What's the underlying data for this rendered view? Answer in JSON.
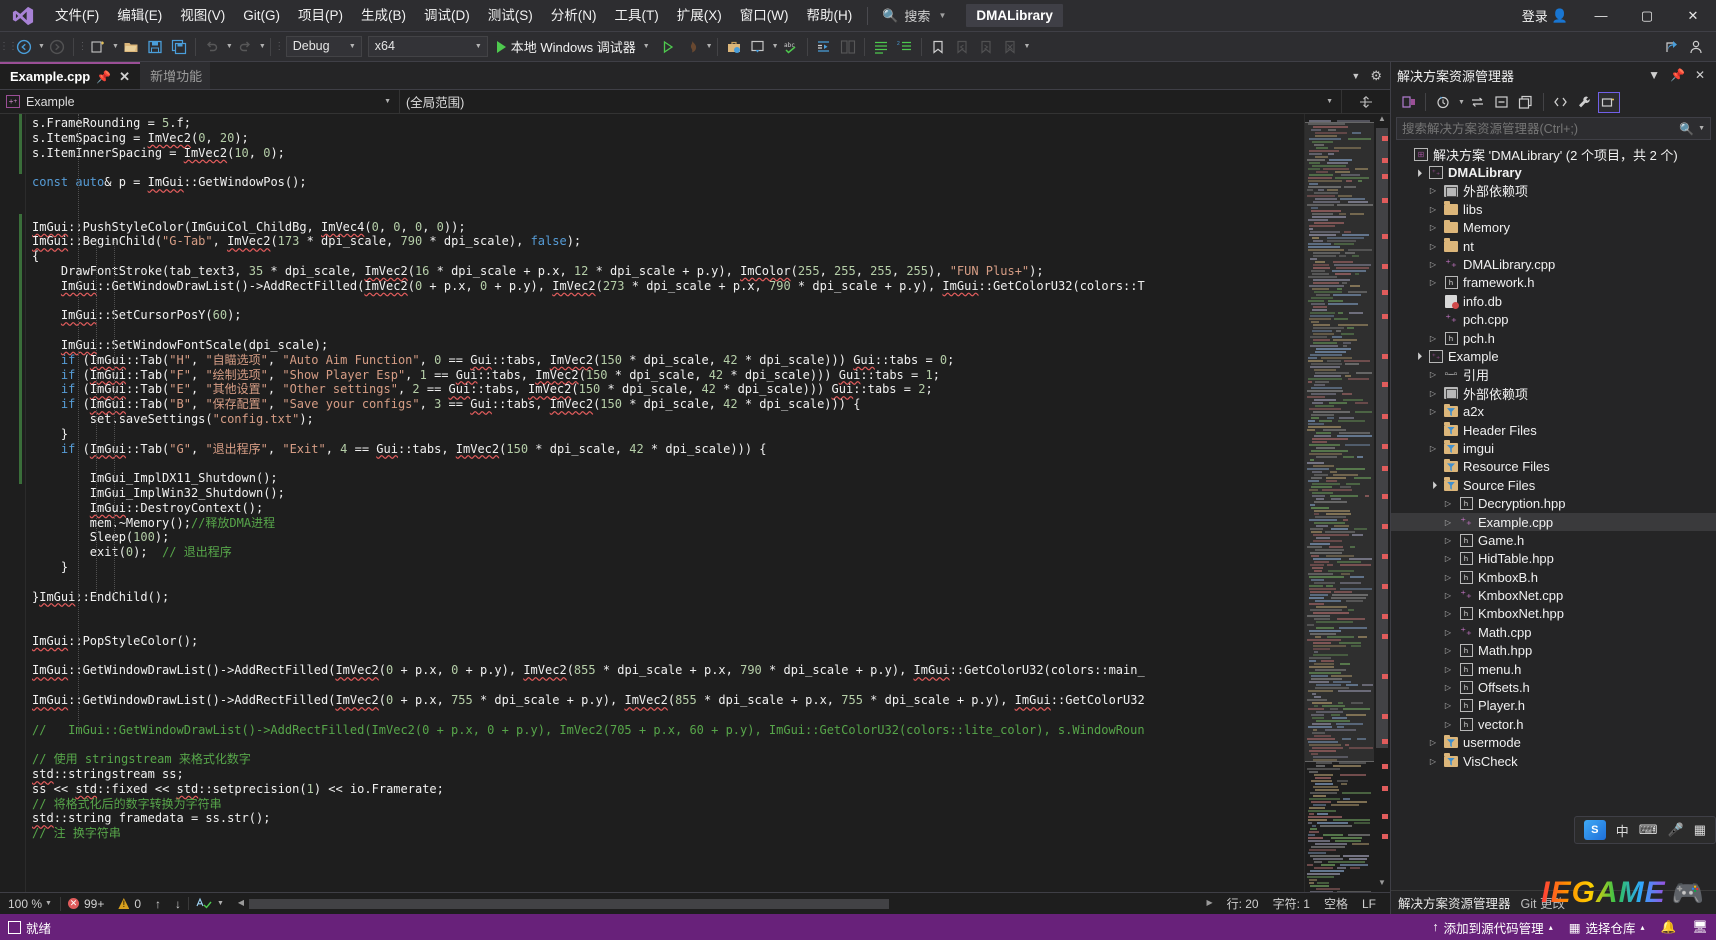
{
  "titlebar": {
    "logo_icon": "visual-studio-logo",
    "menus": [
      {
        "label": "文件(F)"
      },
      {
        "label": "编辑(E)"
      },
      {
        "label": "视图(V)"
      },
      {
        "label": "Git(G)"
      },
      {
        "label": "项目(P)"
      },
      {
        "label": "生成(B)"
      },
      {
        "label": "调试(D)"
      },
      {
        "label": "测试(S)"
      },
      {
        "label": "分析(N)"
      },
      {
        "label": "工具(T)"
      },
      {
        "label": "扩展(X)"
      },
      {
        "label": "窗口(W)"
      },
      {
        "label": "帮助(H)"
      }
    ],
    "search_label": "搜索",
    "search_icon": "search-icon",
    "solution_name": "DMALibrary",
    "signin_label": "登录",
    "signin_icon": "account-icon",
    "minimize_icon": "—",
    "maximize_icon": "▢",
    "close_icon": "✕"
  },
  "toolbar": {
    "back_icon": "navigate-back-icon",
    "forward_icon": "navigate-forward-icon",
    "new_project_icon": "new-project-icon",
    "open_icon": "open-file-icon",
    "save_icon": "save-icon",
    "save_all_icon": "save-all-icon",
    "undo_icon": "undo-icon",
    "redo_icon": "redo-icon",
    "configuration": "Debug",
    "platform": "x64",
    "run_label": "本地 Windows 调试器",
    "run_icon": "play-icon",
    "start_without_debug_icon": "play-outline-icon",
    "hot_reload_icon": "hot-reload-icon",
    "toolbox_icon": "toolbox-icon",
    "window_layout_icon": "window-layout-icon",
    "spellcheck_icon": "abc-check-icon",
    "indent_icon": "indent-icon",
    "compare_icon": "compare-icon",
    "line_icon1": "list-icon",
    "line_icon2": "list-step-icon",
    "bookmark_icon": "bookmark-icon",
    "bookmark_prev_icon": "bookmark-prev-icon",
    "bookmark_next_icon": "bookmark-next-icon",
    "bookmark_clear_icon": "bookmark-clear-icon",
    "share_icon": "share-icon",
    "feedback_icon": "feedback-icon"
  },
  "tabs": [
    {
      "label": "Example.cpp",
      "active": true,
      "pin_icon": "pin-icon",
      "close_icon": "✕"
    },
    {
      "label": "新增功能",
      "active": false
    }
  ],
  "tabstrip": {
    "chevron_icon": "chevron-down-icon",
    "settings_icon": "gear-icon"
  },
  "navbar": {
    "scope_left": "Example",
    "scope_right": "(全局范围)",
    "split_icon": "split-window-icon"
  },
  "code": {
    "lines": [
      "s.FrameRounding = 5.f;",
      "s.ItemSpacing = ImVec2(0, 20);",
      "s.ItemInnerSpacing = ImVec2(10, 0);",
      "",
      "const auto& p = ImGui::GetWindowPos();",
      "",
      "",
      "ImGui::PushStyleColor(ImGuiCol_ChildBg, ImVec4(0, 0, 0, 0));",
      "ImGui::BeginChild(\"G-Tab\", ImVec2(173 * dpi_scale, 790 * dpi_scale), false);",
      "{",
      "    DrawFontStroke(tab_text3, 35 * dpi_scale, ImVec2(16 * dpi_scale + p.x, 12 * dpi_scale + p.y), ImColor(255, 255, 255, 255), \"FUN Plus+\");",
      "    ImGui::GetWindowDrawList()->AddRectFilled(ImVec2(0 + p.x, 0 + p.y), ImVec2(273 * dpi_scale + p.x, 790 * dpi_scale + p.y), ImGui::GetColorU32(colors::T",
      "",
      "    ImGui::SetCursorPosY(60);",
      "",
      "    ImGui::SetWindowFontScale(dpi_scale);",
      "    if (ImGui::Tab(\"H\", \"自瞄选项\", \"Auto Aim Function\", 0 == Gui::tabs, ImVec2(150 * dpi_scale, 42 * dpi_scale))) Gui::tabs = 0;",
      "    if (ImGui::Tab(\"F\", \"绘制选项\", \"Show Player Esp\", 1 == Gui::tabs, ImVec2(150 * dpi_scale, 42 * dpi_scale))) Gui::tabs = 1;",
      "    if (ImGui::Tab(\"E\", \"其他设置\", \"Other settings\", 2 == Gui::tabs, ImVec2(150 * dpi_scale, 42 * dpi_scale))) Gui::tabs = 2;",
      "    if (ImGui::Tab(\"B\", \"保存配置\", \"Save your configs\", 3 == Gui::tabs, ImVec2(150 * dpi_scale, 42 * dpi_scale))) {",
      "        set.saveSettings(\"config.txt\");",
      "    }",
      "    if (ImGui::Tab(\"G\", \"退出程序\", \"Exit\", 4 == Gui::tabs, ImVec2(150 * dpi_scale, 42 * dpi_scale))) {",
      "",
      "        ImGui_ImplDX11_Shutdown();",
      "        ImGui_ImplWin32_Shutdown();",
      "        ImGui::DestroyContext();",
      "        mem.~Memory();//释放DMA进程",
      "        Sleep(100);",
      "        exit(0);  // 退出程序",
      "    }",
      "",
      "}ImGui::EndChild();",
      "",
      "",
      "ImGui::PopStyleColor();",
      "",
      "ImGui::GetWindowDrawList()->AddRectFilled(ImVec2(0 + p.x, 0 + p.y), ImVec2(855 * dpi_scale + p.x, 790 * dpi_scale + p.y), ImGui::GetColorU32(colors::main_",
      "",
      "ImGui::GetWindowDrawList()->AddRectFilled(ImVec2(0 + p.x, 755 * dpi_scale + p.y), ImVec2(855 * dpi_scale + p.x, 755 * dpi_scale + p.y), ImGui::GetColorU32",
      "",
      "//   ImGui::GetWindowDrawList()->AddRectFilled(ImVec2(0 + p.x, 0 + p.y), ImVec2(705 + p.x, 60 + p.y), ImGui::GetColorU32(colors::lite_color), s.WindowRoun",
      "",
      "// 使用 stringstream 来格式化数字",
      "std::stringstream ss;",
      "ss << std::fixed << std::setprecision(1) << io.Framerate;",
      "// 将格式化后的数字转换为字符串",
      "std::string framedata = ss.str();",
      "// 注 换字符串"
    ]
  },
  "editor_status": {
    "zoom": "100 %",
    "zoom_caret": "▾",
    "error_count": "99+",
    "warning_count": "0",
    "error_icon": "error-circle-icon",
    "warning_icon": "warning-triangle-icon",
    "prev_issue_icon": "↑",
    "next_issue_icon": "↓",
    "spell_icon": "spellcheck-icon",
    "line_label": "行: 20",
    "col_label": "字符: 1",
    "insert_mode": "空格",
    "eol": "LF",
    "scroll_left_icon": "◀",
    "scroll_right_icon": "▶"
  },
  "solution_explorer": {
    "title": "解决方案资源管理器",
    "chevron_icon": "chevron-down-icon",
    "pin_icon": "pin-icon",
    "close_icon": "✕",
    "toolbar": [
      {
        "name": "back-to-solution-icon",
        "glyph": "⌸"
      },
      {
        "name": "pending-changes-icon",
        "glyph": "◔"
      },
      {
        "name": "sync-with-active-document-icon",
        "glyph": "⇆"
      },
      {
        "name": "collapse-all-icon",
        "glyph": "⊟"
      },
      {
        "name": "properties-window-icon",
        "glyph": "❐"
      },
      {
        "name": "show-all-files-icon",
        "glyph": "<>"
      },
      {
        "name": "properties-icon",
        "glyph": "🔧"
      },
      {
        "name": "solution-explorer-view-icon",
        "glyph": "▱"
      }
    ],
    "search_placeholder": "搜索解决方案资源管理器(Ctrl+;)",
    "search_icon": "search-icon",
    "search_caret": "▾",
    "tree": [
      {
        "label": "解决方案 'DMALibrary' (2 个项目，共 2 个)",
        "indent": 0,
        "arrow": "",
        "icon": "solution",
        "bold": false
      },
      {
        "label": "DMALibrary",
        "indent": 1,
        "arrow": "open",
        "icon": "cpp-project",
        "bold": true
      },
      {
        "label": "外部依赖项",
        "indent": 2,
        "arrow": "closed",
        "icon": "ext-dep",
        "bold": false
      },
      {
        "label": "libs",
        "indent": 2,
        "arrow": "closed",
        "icon": "folder",
        "bold": false
      },
      {
        "label": "Memory",
        "indent": 2,
        "arrow": "closed",
        "icon": "folder",
        "bold": false
      },
      {
        "label": "nt",
        "indent": 2,
        "arrow": "closed",
        "icon": "folder",
        "bold": false
      },
      {
        "label": "DMALibrary.cpp",
        "indent": 2,
        "arrow": "closed",
        "icon": "cpp",
        "bold": false
      },
      {
        "label": "framework.h",
        "indent": 2,
        "arrow": "closed",
        "icon": "header",
        "bold": false
      },
      {
        "label": "info.db",
        "indent": 2,
        "arrow": "",
        "icon": "db",
        "bold": false
      },
      {
        "label": "pch.cpp",
        "indent": 2,
        "arrow": "",
        "icon": "cpp",
        "bold": false
      },
      {
        "label": "pch.h",
        "indent": 2,
        "arrow": "closed",
        "icon": "header",
        "bold": false
      },
      {
        "label": "Example",
        "indent": 1,
        "arrow": "open",
        "icon": "cpp-project",
        "bold": false
      },
      {
        "label": "引用",
        "indent": 2,
        "arrow": "closed",
        "icon": "ref",
        "bold": false
      },
      {
        "label": "外部依赖项",
        "indent": 2,
        "arrow": "closed",
        "icon": "ext-dep",
        "bold": false
      },
      {
        "label": "a2x",
        "indent": 2,
        "arrow": "closed",
        "icon": "filter",
        "bold": false
      },
      {
        "label": "Header Files",
        "indent": 2,
        "arrow": "",
        "icon": "filter",
        "bold": false
      },
      {
        "label": "imgui",
        "indent": 2,
        "arrow": "closed",
        "icon": "filter",
        "bold": false
      },
      {
        "label": "Resource Files",
        "indent": 2,
        "arrow": "",
        "icon": "filter",
        "bold": false
      },
      {
        "label": "Source Files",
        "indent": 2,
        "arrow": "open",
        "icon": "filter",
        "bold": false
      },
      {
        "label": "Decryption.hpp",
        "indent": 3,
        "arrow": "closed",
        "icon": "header",
        "bold": false
      },
      {
        "label": "Example.cpp",
        "indent": 3,
        "arrow": "closed",
        "icon": "cpp",
        "bold": false,
        "selected": true
      },
      {
        "label": "Game.h",
        "indent": 3,
        "arrow": "closed",
        "icon": "header",
        "bold": false
      },
      {
        "label": "HidTable.hpp",
        "indent": 3,
        "arrow": "closed",
        "icon": "header",
        "bold": false
      },
      {
        "label": "KmboxB.h",
        "indent": 3,
        "arrow": "closed",
        "icon": "header",
        "bold": false
      },
      {
        "label": "KmboxNet.cpp",
        "indent": 3,
        "arrow": "closed",
        "icon": "cpp",
        "bold": false
      },
      {
        "label": "KmboxNet.hpp",
        "indent": 3,
        "arrow": "closed",
        "icon": "header",
        "bold": false
      },
      {
        "label": "Math.cpp",
        "indent": 3,
        "arrow": "closed",
        "icon": "cpp",
        "bold": false
      },
      {
        "label": "Math.hpp",
        "indent": 3,
        "arrow": "closed",
        "icon": "header",
        "bold": false
      },
      {
        "label": "menu.h",
        "indent": 3,
        "arrow": "closed",
        "icon": "header",
        "bold": false
      },
      {
        "label": "Offsets.h",
        "indent": 3,
        "arrow": "closed",
        "icon": "header",
        "bold": false
      },
      {
        "label": "Player.h",
        "indent": 3,
        "arrow": "closed",
        "icon": "header",
        "bold": false
      },
      {
        "label": "vector.h",
        "indent": 3,
        "arrow": "closed",
        "icon": "header",
        "bold": false
      },
      {
        "label": "usermode",
        "indent": 2,
        "arrow": "closed",
        "icon": "filter",
        "bold": false
      },
      {
        "label": "VisCheck",
        "indent": 2,
        "arrow": "closed",
        "icon": "filter",
        "bold": false
      }
    ],
    "footer_left": "解决方案资源管理器",
    "footer_right": "Git 更改"
  },
  "statusbar": {
    "ready_label": "就绪",
    "ready_icon": "flag-icon",
    "source_control_label": "添加到源代码管理",
    "source_control_icon": "up-arrow-icon",
    "repo_label": "选择仓库",
    "repo_icon": "repo-icon",
    "caret": "▴",
    "notify_icon": "bell-icon",
    "monitor_icon": "monitor-icon"
  },
  "ime": {
    "logo_text": "S",
    "mode": "中",
    "items": [
      "⌨",
      "🎤",
      "▦"
    ],
    "icon_names": [
      "keyboard-icon",
      "microphone-icon",
      "panel-icon"
    ]
  },
  "watermark": {
    "text": "IEGAME",
    "pad_icon": "🎮"
  },
  "colors": {
    "accent": "#68217a",
    "tab_accent": "#9b4f96",
    "titlebar_bg": "#2d2d30",
    "editor_bg": "#1e1e1e",
    "panel_bg": "#252526",
    "keyword": "#569cd6",
    "string": "#d69d85",
    "comment": "#57a64a",
    "number": "#b5cea8",
    "error": "#e05c5c"
  }
}
